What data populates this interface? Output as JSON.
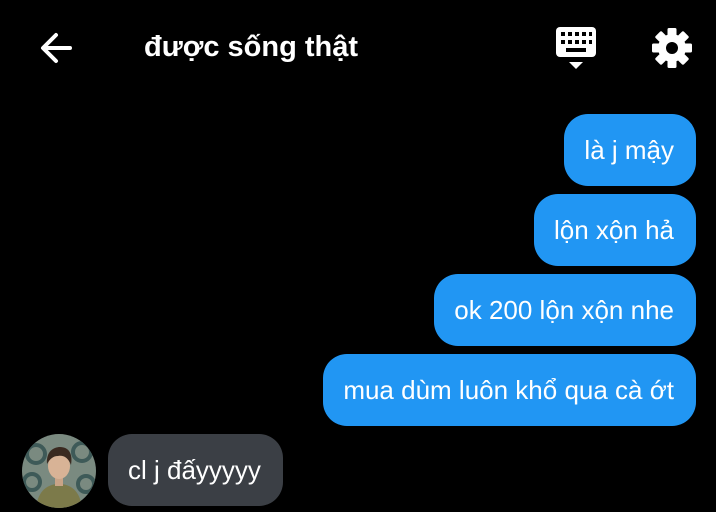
{
  "header": {
    "title": "được sống thật",
    "icons": {
      "back": "arrow-left-icon",
      "keyboard": "keyboard-icon",
      "settings": "gear-icon"
    }
  },
  "messages": [
    {
      "direction": "outgoing",
      "text": "là j mậy"
    },
    {
      "direction": "outgoing",
      "text": "lộn xộn hả"
    },
    {
      "direction": "outgoing",
      "text": "ok 200 lộn xộn nhe"
    },
    {
      "direction": "outgoing",
      "text": "mua dùm luôn khổ qua cà ớt"
    },
    {
      "direction": "incoming",
      "text": "cl j đấyyyyy"
    }
  ],
  "colors": {
    "background": "#000000",
    "outgoing_bubble": "#2196f3",
    "incoming_bubble": "#3b3f45",
    "text": "#ffffff"
  }
}
